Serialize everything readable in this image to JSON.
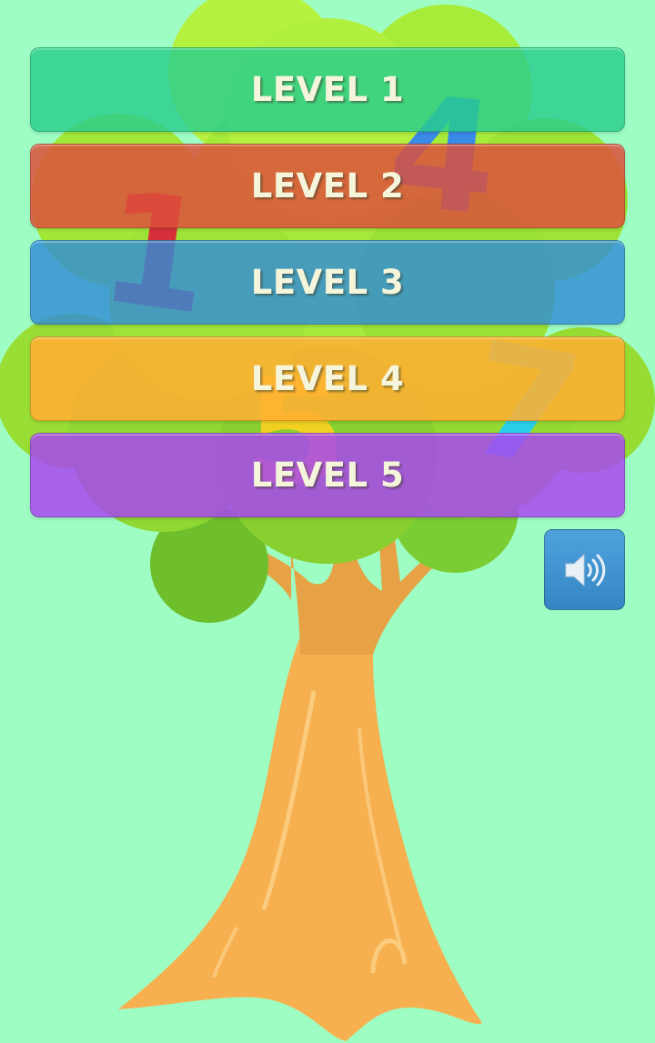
{
  "background_color": "#9efdc3",
  "levels": [
    {
      "label": "LEVEL 1",
      "color": "#28cd8c"
    },
    {
      "label": "LEVEL 2",
      "color": "#dc503c"
    },
    {
      "label": "LEVEL 3",
      "color": "#328cd7"
    },
    {
      "label": "LEVEL 4",
      "color": "#ffaf32"
    },
    {
      "label": "LEVEL 5",
      "color": "#a846f0"
    }
  ],
  "sound_button": {
    "icon": "speaker-volume-icon",
    "color": "#3e94d0"
  },
  "background_art": {
    "description_icon": "tree-illustration",
    "digits": [
      "1",
      "4",
      "5",
      "7"
    ]
  }
}
